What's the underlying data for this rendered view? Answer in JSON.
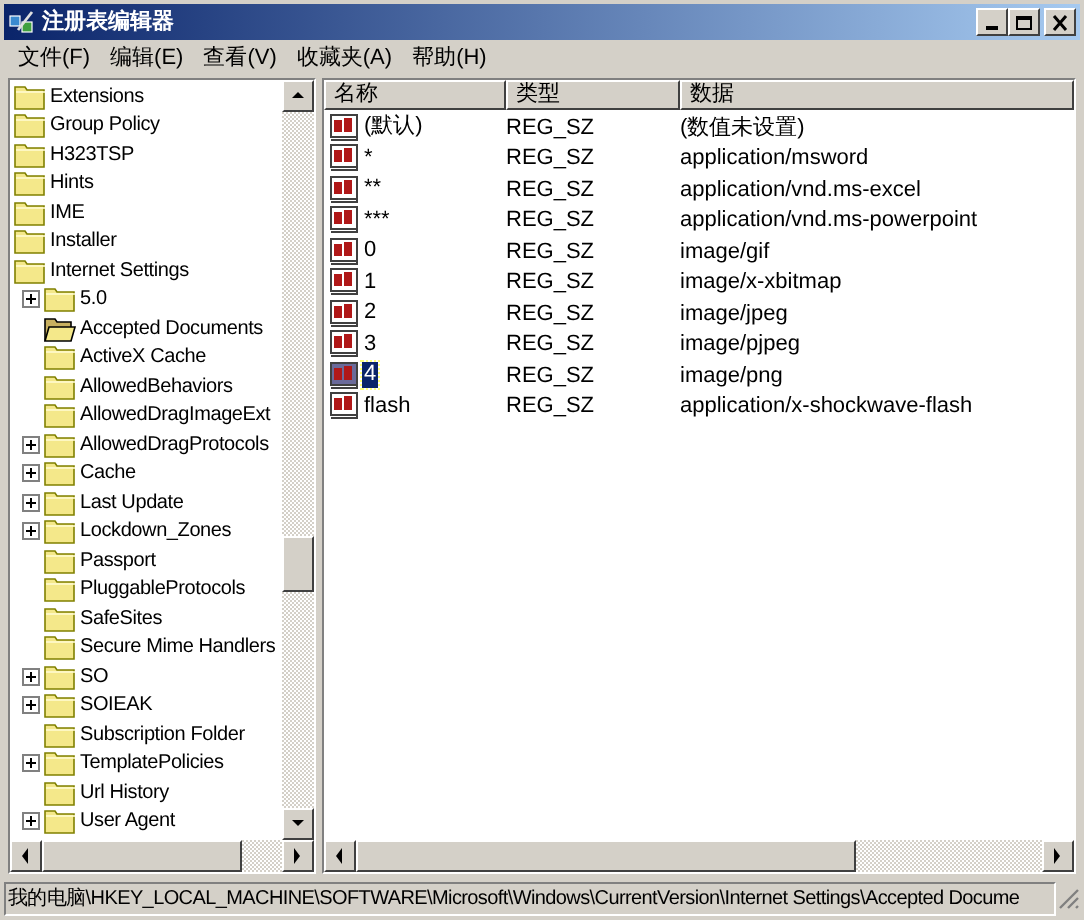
{
  "window": {
    "title": "注册表编辑器"
  },
  "menu": [
    "文件(F)",
    "编辑(E)",
    "查看(V)",
    "收藏夹(A)",
    "帮助(H)"
  ],
  "tree": [
    {
      "label": "Extensions",
      "selected": false
    },
    {
      "label": "Group Policy",
      "selected": false
    },
    {
      "label": "H323TSP",
      "selected": false
    },
    {
      "label": "Hints",
      "selected": false
    },
    {
      "label": "IME",
      "selected": false
    },
    {
      "label": "Installer",
      "selected": false
    },
    {
      "label": "Internet Settings",
      "selected": false,
      "children": [
        {
          "label": "5.0",
          "expandable": true,
          "selected": false
        },
        {
          "label": "Accepted Documents",
          "expandable": false,
          "selected": true
        },
        {
          "label": "ActiveX Cache",
          "expandable": false,
          "selected": false
        },
        {
          "label": "AllowedBehaviors",
          "expandable": false,
          "selected": false
        },
        {
          "label": "AllowedDragImageExt",
          "expandable": false,
          "selected": false
        },
        {
          "label": "AllowedDragProtocols",
          "expandable": true,
          "selected": false
        },
        {
          "label": "Cache",
          "expandable": true,
          "selected": false
        },
        {
          "label": "Last Update",
          "expandable": true,
          "selected": false
        },
        {
          "label": "Lockdown_Zones",
          "expandable": true,
          "selected": false
        },
        {
          "label": "Passport",
          "expandable": false,
          "selected": false
        },
        {
          "label": "PluggableProtocols",
          "expandable": false,
          "selected": false
        },
        {
          "label": "SafeSites",
          "expandable": false,
          "selected": false
        },
        {
          "label": "Secure Mime Handlers",
          "expandable": false,
          "selected": false
        },
        {
          "label": "SO",
          "expandable": true,
          "selected": false
        },
        {
          "label": "SOIEAK",
          "expandable": true,
          "selected": false
        },
        {
          "label": "Subscription Folder",
          "expandable": false,
          "selected": false
        },
        {
          "label": "TemplatePolicies",
          "expandable": true,
          "selected": false
        },
        {
          "label": "Url History",
          "expandable": false,
          "selected": false
        },
        {
          "label": "User Agent",
          "expandable": true,
          "selected": false
        }
      ]
    }
  ],
  "table": {
    "columns": [
      "名称",
      "类型",
      "数据"
    ],
    "rows": [
      {
        "name": "(默认)",
        "type": "REG_SZ",
        "data": "(数值未设置)",
        "selected": false
      },
      {
        "name": "*",
        "type": "REG_SZ",
        "data": "application/msword",
        "selected": false
      },
      {
        "name": "**",
        "type": "REG_SZ",
        "data": "application/vnd.ms-excel",
        "selected": false
      },
      {
        "name": "***",
        "type": "REG_SZ",
        "data": "application/vnd.ms-powerpoint",
        "selected": false
      },
      {
        "name": "0",
        "type": "REG_SZ",
        "data": "image/gif",
        "selected": false
      },
      {
        "name": "1",
        "type": "REG_SZ",
        "data": "image/x-xbitmap",
        "selected": false
      },
      {
        "name": "2",
        "type": "REG_SZ",
        "data": "image/jpeg",
        "selected": false
      },
      {
        "name": "3",
        "type": "REG_SZ",
        "data": "image/pjpeg",
        "selected": false
      },
      {
        "name": "4",
        "type": "REG_SZ",
        "data": "image/png",
        "selected": true
      },
      {
        "name": "flash",
        "type": "REG_SZ",
        "data": "application/x-shockwave-flash",
        "selected": false
      }
    ]
  },
  "status_bar": "我的电脑\\HKEY_LOCAL_MACHINE\\SOFTWARE\\Microsoft\\Windows\\CurrentVersion\\Internet Settings\\Accepted Docume"
}
